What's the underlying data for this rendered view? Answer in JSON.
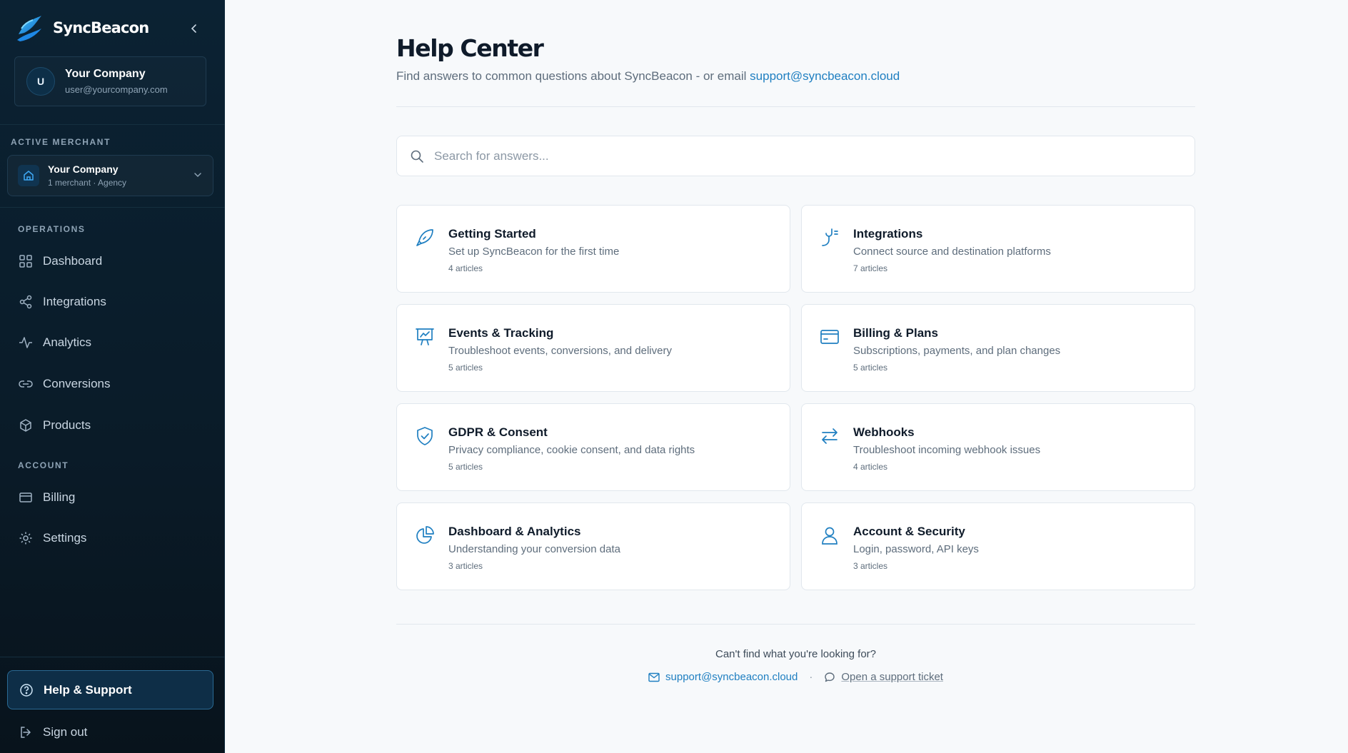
{
  "sidebar": {
    "brand": "SyncBeacon",
    "user": {
      "initial": "U",
      "name": "Your Company",
      "email": "user@yourcompany.com"
    },
    "active_merchant_label": "ACTIVE MERCHANT",
    "merchant": {
      "name": "Your Company",
      "meta": "1 merchant · Agency"
    },
    "operations_label": "OPERATIONS",
    "operations": [
      {
        "label": "Dashboard",
        "icon": "grid-icon"
      },
      {
        "label": "Integrations",
        "icon": "share-icon"
      },
      {
        "label": "Analytics",
        "icon": "activity-icon"
      },
      {
        "label": "Conversions",
        "icon": "link-icon"
      },
      {
        "label": "Products",
        "icon": "box-icon"
      }
    ],
    "account_label": "ACCOUNT",
    "account": [
      {
        "label": "Billing",
        "icon": "credit-card-icon"
      },
      {
        "label": "Settings",
        "icon": "gear-icon"
      }
    ],
    "help": {
      "label": "Help & Support",
      "icon": "help-circle-icon"
    },
    "signout": {
      "label": "Sign out",
      "icon": "sign-out-icon"
    }
  },
  "main": {
    "title": "Help Center",
    "subtitle": "Find answers to common questions about SyncBeacon - or email",
    "support_email": "support@syncbeacon.cloud",
    "search_placeholder": "Search for answers...",
    "categories": [
      {
        "title": "Getting Started",
        "desc": "Set up SyncBeacon for the first time",
        "count": "4 articles",
        "icon": "rocket-icon"
      },
      {
        "title": "Integrations",
        "desc": "Connect source and destination platforms",
        "count": "7 articles",
        "icon": "plug-icon"
      },
      {
        "title": "Events & Tracking",
        "desc": "Troubleshoot events, conversions, and delivery",
        "count": "5 articles",
        "icon": "presentation-chart-icon"
      },
      {
        "title": "Billing & Plans",
        "desc": "Subscriptions, payments, and plan changes",
        "count": "5 articles",
        "icon": "credit-card-icon"
      },
      {
        "title": "GDPR & Consent",
        "desc": "Privacy compliance, cookie consent, and data rights",
        "count": "5 articles",
        "icon": "shield-check-icon"
      },
      {
        "title": "Webhooks",
        "desc": "Troubleshoot incoming webhook issues",
        "count": "4 articles",
        "icon": "arrows-exchange-icon"
      },
      {
        "title": "Dashboard & Analytics",
        "desc": "Understanding your conversion data",
        "count": "3 articles",
        "icon": "pie-chart-icon"
      },
      {
        "title": "Account & Security",
        "desc": "Login, password, API keys",
        "count": "3 articles",
        "icon": "user-icon"
      }
    ],
    "footer": {
      "question": "Can't find what you're looking for?",
      "email": "support@syncbeacon.cloud",
      "separator": "·",
      "ticket": "Open a support ticket"
    }
  },
  "colors": {
    "accent": "#1f7fc1",
    "sidebar_bg": "#0a1b28",
    "page_bg": "#f7f9fb"
  }
}
